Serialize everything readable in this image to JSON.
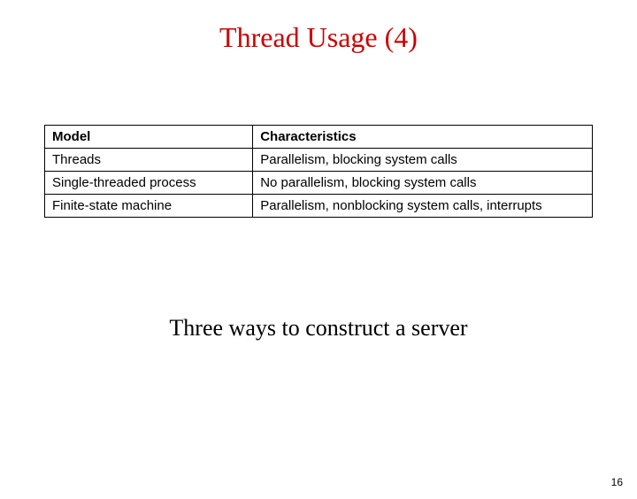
{
  "title": "Thread Usage (4)",
  "table": {
    "headers": {
      "model": "Model",
      "characteristics": "Characteristics"
    },
    "rows": [
      {
        "model": "Threads",
        "characteristics": "Parallelism, blocking system calls"
      },
      {
        "model": "Single-threaded process",
        "characteristics": "No parallelism, blocking system calls"
      },
      {
        "model": "Finite-state machine",
        "characteristics": "Parallelism, nonblocking system calls, interrupts"
      }
    ]
  },
  "caption": "Three ways to construct a server",
  "page_number": "16",
  "chart_data": {
    "type": "table",
    "title": "Thread Usage (4)",
    "columns": [
      "Model",
      "Characteristics"
    ],
    "rows": [
      [
        "Threads",
        "Parallelism, blocking system calls"
      ],
      [
        "Single-threaded process",
        "No parallelism, blocking system calls"
      ],
      [
        "Finite-state machine",
        "Parallelism, nonblocking system calls, interrupts"
      ]
    ],
    "caption": "Three ways to construct a server"
  }
}
